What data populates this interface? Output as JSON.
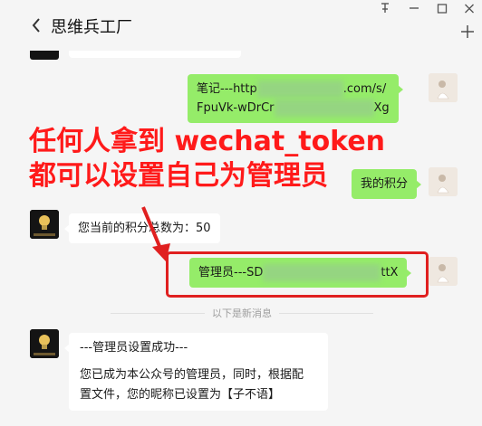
{
  "header": {
    "back_icon": "chevron-left-icon",
    "title": "思维兵工厂",
    "pin_glyph": "ㅏ",
    "minimize_glyph": "—",
    "maximize_glyph": "☐",
    "close_glyph": "✕",
    "add_glyph": "+"
  },
  "messages": [
    {
      "from": "me",
      "line1_a": "笔记---http",
      "line1_b": ".com/s/",
      "line2_a": "FpuVk-wDrCr",
      "line2_b": "Xg"
    },
    {
      "from": "me",
      "text": "我的积分"
    },
    {
      "from": "bot",
      "text": "您当前的积分总数为：50"
    },
    {
      "from": "me",
      "text_a": "管理员---SD",
      "text_b": "ttX"
    }
  ],
  "divider": {
    "label": "以下是新消息"
  },
  "final_message": {
    "from": "bot",
    "line1": "---管理员设置成功---",
    "line2": "您已成为本公众号的管理员，同时，根据配",
    "line3": "置文件，您的昵称已设置为【子不语】"
  },
  "annotation": {
    "line1": "任何人拿到 wechat_token",
    "line2": "都可以设置自己为管理员",
    "color": "#ff1a1a"
  },
  "colors": {
    "green_bubble": "#95ec69",
    "background": "#f5f5f5",
    "highlight": "#e02020"
  }
}
